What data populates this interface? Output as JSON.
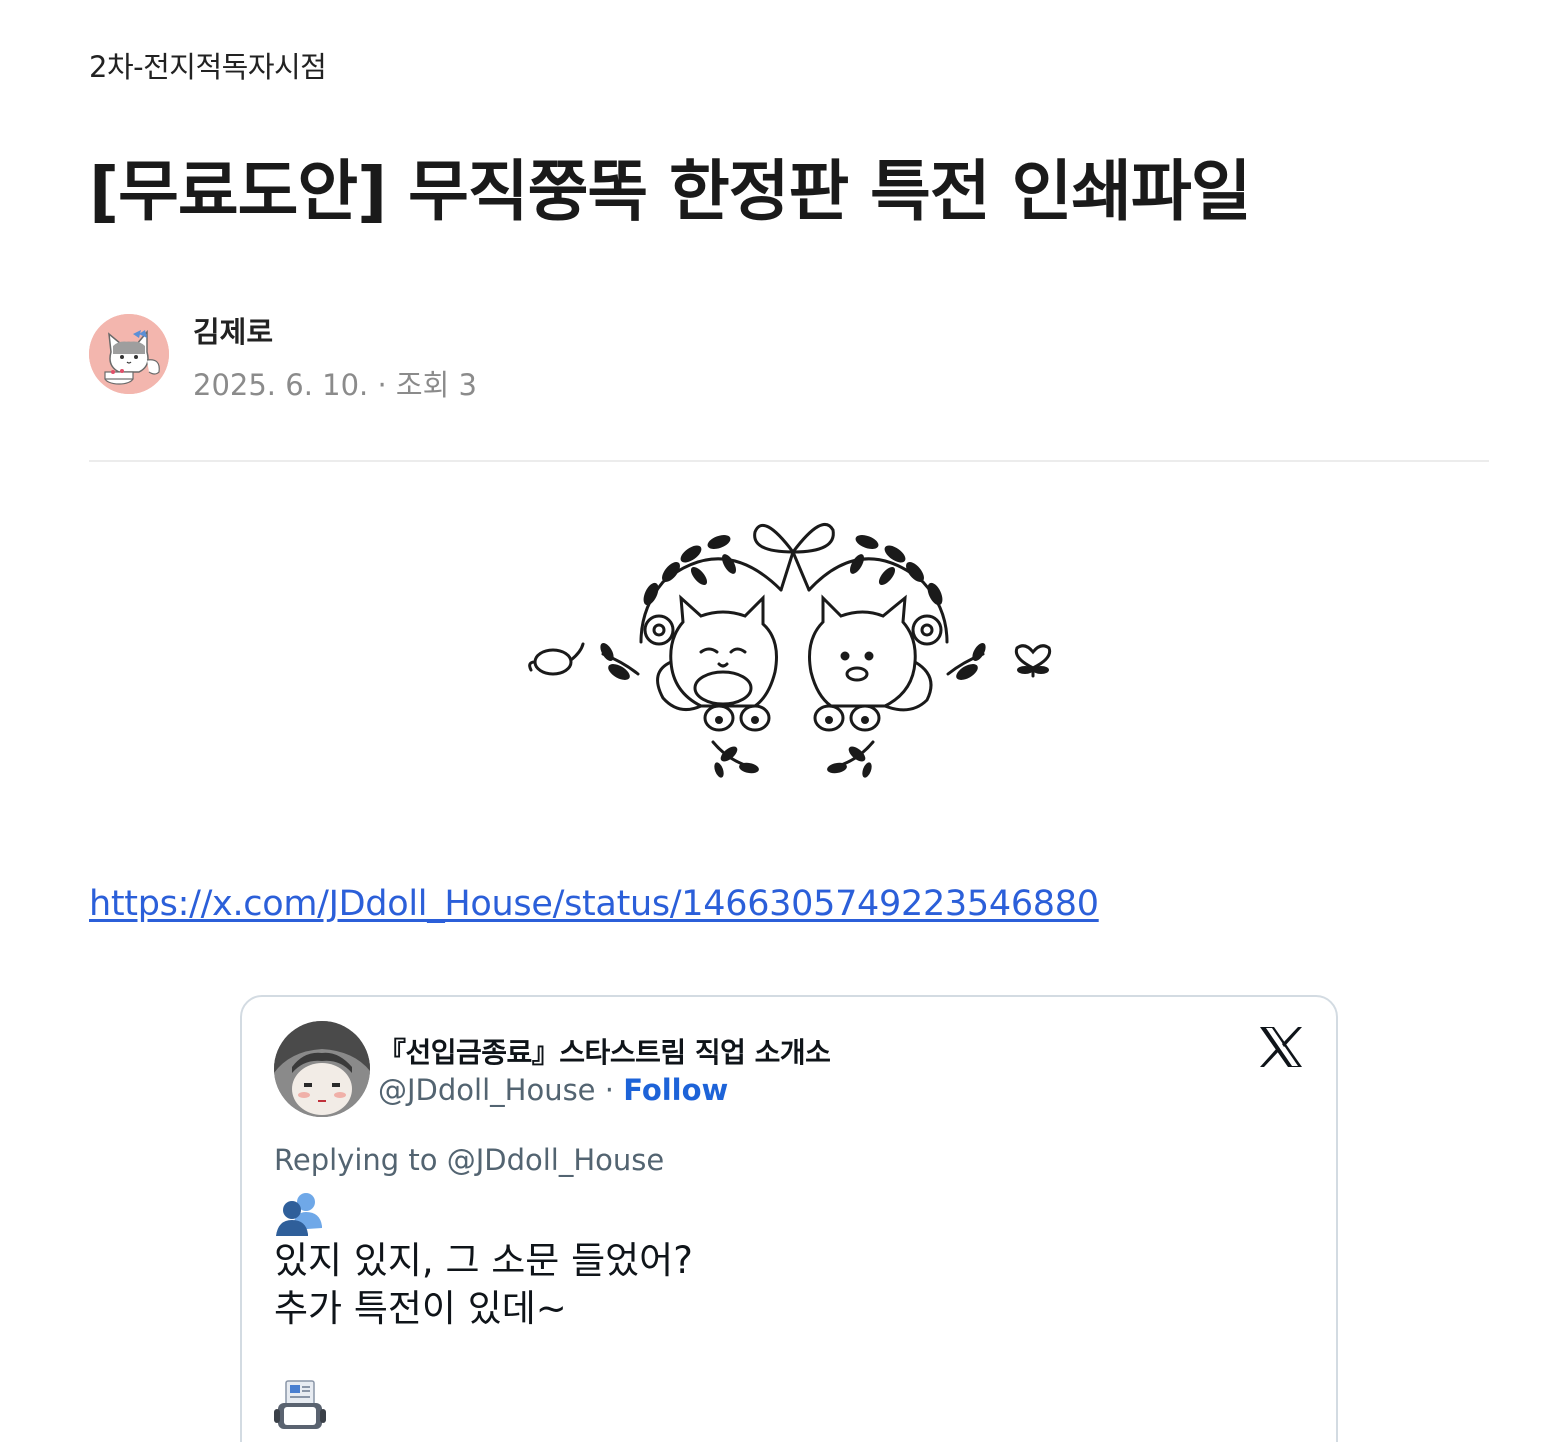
{
  "post": {
    "category": "2차-전지적독자시점",
    "title": "[무료도안] 무직쭝똑 한정판 특전 인쇄파일",
    "author": "김제로",
    "date": "2025. 6. 10.",
    "meta_separator": "·",
    "views_label": "조회 3",
    "link": "https://x.com/JDdoll_House/status/1466305749223546880"
  },
  "embed": {
    "display_name": "『선입금종료』스타스트림 직업 소개소",
    "handle": "@JDdoll_House",
    "separator": "·",
    "follow_label": "Follow",
    "replying_to": "Replying to @JDdoll_House",
    "text_lines": "있지 있지, 그 소문 들었어?\n추가 특전이 있데~"
  },
  "icons": {
    "author_avatar": "avatar-cat-illustration",
    "embed_avatar": "avatar-doll-photo",
    "x_logo": "x-logo-icon",
    "emoji_1": "busts-in-silhouette-emoji",
    "emoji_2": "fax-machine-emoji"
  },
  "colors": {
    "link": "#2b5fd9",
    "follow": "#1d63d8",
    "muted": "#8b8b8b",
    "avatar_bg": "#f3b6ae"
  }
}
